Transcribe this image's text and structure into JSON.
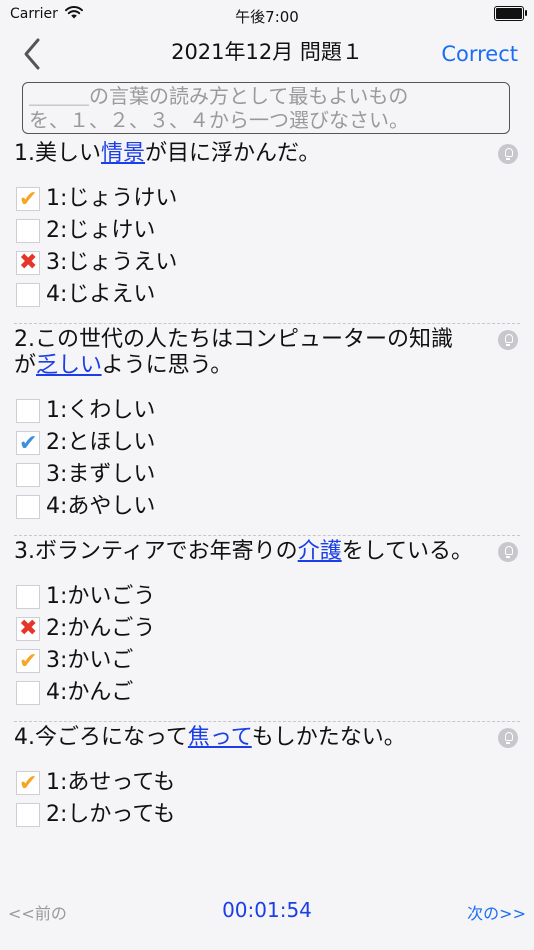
{
  "status": {
    "carrier": "Carrier",
    "time": "午後7:00",
    "battery_level": 1.0
  },
  "nav": {
    "title": "2021年12月 問題１",
    "correct_label": "Correct"
  },
  "instruction": {
    "lines": [
      "＿＿＿の言葉の読み方として最もよいもの",
      "を、１、２、３、４から一つ選びなさい。"
    ]
  },
  "questions": [
    {
      "number": "1.",
      "text_parts": [
        {
          "text": "美しい",
          "hl": false
        },
        {
          "text": "情景",
          "hl": true
        },
        {
          "text": "が目に浮かんだ。",
          "hl": false
        }
      ],
      "options": [
        {
          "label": "1:",
          "text": "じょうけい",
          "mark": "check-orange"
        },
        {
          "label": "2:",
          "text": "じょけい",
          "mark": ""
        },
        {
          "label": "3:",
          "text": "じょうえい",
          "mark": "cross"
        },
        {
          "label": "4:",
          "text": "じよえい",
          "mark": ""
        }
      ]
    },
    {
      "number": "2.",
      "text_parts": [
        {
          "text": "この世代の人たちはコンピューターの知識が",
          "hl": false
        },
        {
          "text": "乏しい",
          "hl": true
        },
        {
          "text": "ように思う。",
          "hl": false
        }
      ],
      "options": [
        {
          "label": "1:",
          "text": "くわしい",
          "mark": ""
        },
        {
          "label": "2:",
          "text": "とほしい",
          "mark": "check-blue"
        },
        {
          "label": "3:",
          "text": "まずしい",
          "mark": ""
        },
        {
          "label": "4:",
          "text": "あやしい",
          "mark": ""
        }
      ]
    },
    {
      "number": "3.",
      "text_parts": [
        {
          "text": "ボランティアでお年寄りの",
          "hl": false
        },
        {
          "text": "介護",
          "hl": true
        },
        {
          "text": "をしている。",
          "hl": false
        }
      ],
      "options": [
        {
          "label": "1:",
          "text": "かいごう",
          "mark": ""
        },
        {
          "label": "2:",
          "text": "かんごう",
          "mark": "cross"
        },
        {
          "label": "3:",
          "text": "かいご",
          "mark": "check-orange"
        },
        {
          "label": "4:",
          "text": "かんご",
          "mark": ""
        }
      ]
    },
    {
      "number": "4.",
      "text_parts": [
        {
          "text": "今ごろになって",
          "hl": false
        },
        {
          "text": "焦って",
          "hl": true
        },
        {
          "text": "もしかたない。",
          "hl": false
        }
      ],
      "options": [
        {
          "label": "1:",
          "text": "あせっても",
          "mark": "check-orange"
        },
        {
          "label": "2:",
          "text": "しかっても",
          "mark": ""
        }
      ]
    }
  ],
  "bottom": {
    "prev_label": "<<前の",
    "timer": "00:01:54",
    "next_label": "次の>>"
  }
}
